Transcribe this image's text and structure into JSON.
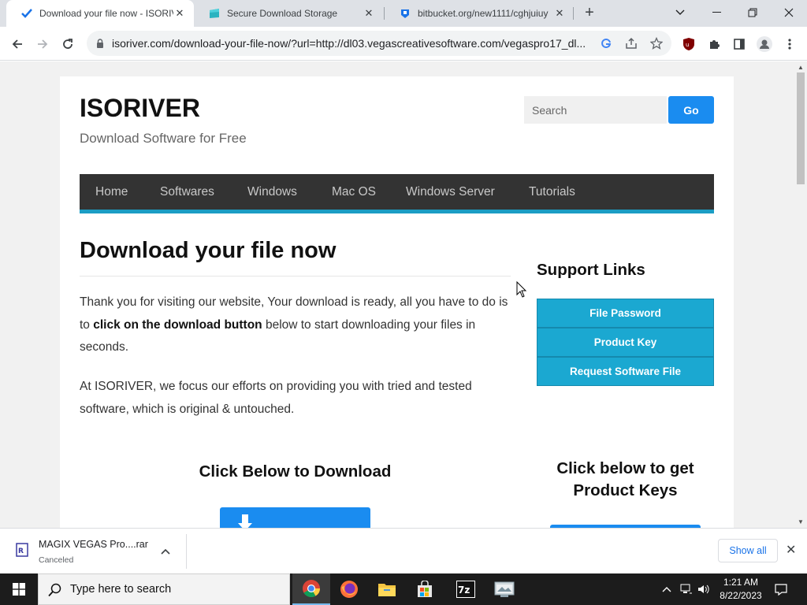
{
  "browser": {
    "tabs": [
      {
        "title": "Download your file now - ISORIVER",
        "active": true
      },
      {
        "title": "Secure Download Storage",
        "active": false
      },
      {
        "title": "bitbucket.org/new1111/cghjuiuy",
        "active": false
      }
    ],
    "url": "isoriver.com/download-your-file-now/?url=http://dl03.vegascreativesoftware.com/vegaspro17_dl..."
  },
  "site": {
    "title": "ISORIVER",
    "tagline": "Download Software for Free",
    "search_placeholder": "Search",
    "go_label": "Go",
    "nav": [
      "Home",
      "Softwares",
      "Windows",
      "Mac OS",
      "Windows Server",
      "Tutorials"
    ]
  },
  "main": {
    "heading": "Download your file now",
    "para1_a": "Thank you for visiting our website, Your download is ready, all you have to do is to ",
    "para1_b": "click on the download button",
    "para1_c": " below to start downloading your files in seconds.",
    "para2": "At ISORIVER, we focus our efforts on providing you with tried and tested software, which is original & untouched.",
    "download_heading": "Click Below to Download"
  },
  "sidebar": {
    "heading": "Support Links",
    "links": [
      "File Password",
      "Product Key",
      "Request Software File"
    ],
    "keys_heading": "Click below to get Product Keys"
  },
  "download_shelf": {
    "filename": "MAGIX VEGAS Pro....rar",
    "status": "Canceled",
    "show_all": "Show all"
  },
  "taskbar": {
    "search_text": "Type here to search",
    "time": "1:21 AM",
    "date": "8/22/2023"
  },
  "colors": {
    "accent_blue": "#1a8cf0",
    "support_teal": "#1ba8d1",
    "nav_bar": "#333333",
    "nav_underline": "#1b9dc4"
  }
}
